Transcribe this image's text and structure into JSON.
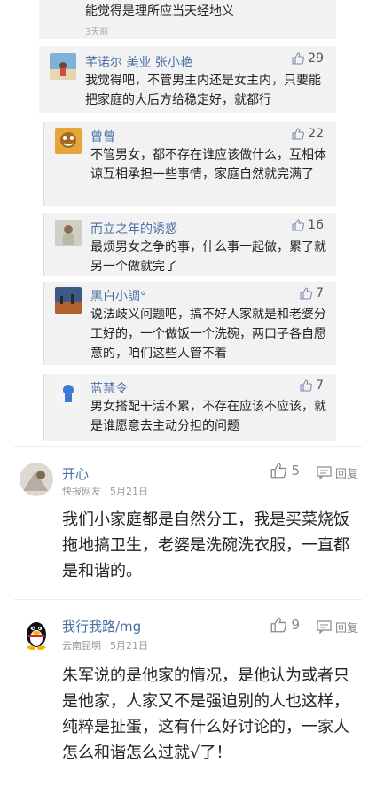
{
  "replies": [
    {
      "text": "能觉得是理所应当天经地义",
      "time": "3天前"
    },
    {
      "name": "芊诺尔 美业 张小艳",
      "likes": "29",
      "text": "我觉得吧，不管男主内还是女主内，只要能把家庭的大后方给稳定好，就都行"
    },
    {
      "name": "曾曾",
      "likes": "22",
      "text": "不管男女，都不存在谁应该做什么，互相体谅互相承担一些事情，家庭自然就完满了"
    },
    {
      "name": "而立之年的诱惑",
      "likes": "16",
      "text": "最烦男女之争的事，什么事一起做，累了就另一个做就完了"
    },
    {
      "name": "黑白小調°",
      "likes": "7",
      "text": "说法歧义问题吧，搞不好人家就是和老婆分工好的，一个做饭一个洗碗，两口子各自愿意的，咱们这些人管不着"
    },
    {
      "name": "蓝禁令",
      "likes": "7",
      "text": "男女搭配干活不累，不存在应该不应该，就是谁愿意去主动分担的问题"
    }
  ],
  "comments": [
    {
      "name": "开心",
      "location": "快报网友",
      "date": "5月21日",
      "likes": "5",
      "reply_label": "回复",
      "text": "我们小家庭都是自然分工，我是买菜烧饭拖地搞卫生，老婆是洗碗洗衣服，一直都是和谐的。"
    },
    {
      "name": "我行我路/mg",
      "location": "云南昆明",
      "date": "5月21日",
      "likes": "9",
      "reply_label": "回复",
      "text": "朱军说的是他家的情况，是他认为或者只是他家，人家又不是强迫别的人也这样，纯粹是扯蛋，这有什么好讨论的，一家人怎么和谐怎么过就√了！"
    }
  ]
}
